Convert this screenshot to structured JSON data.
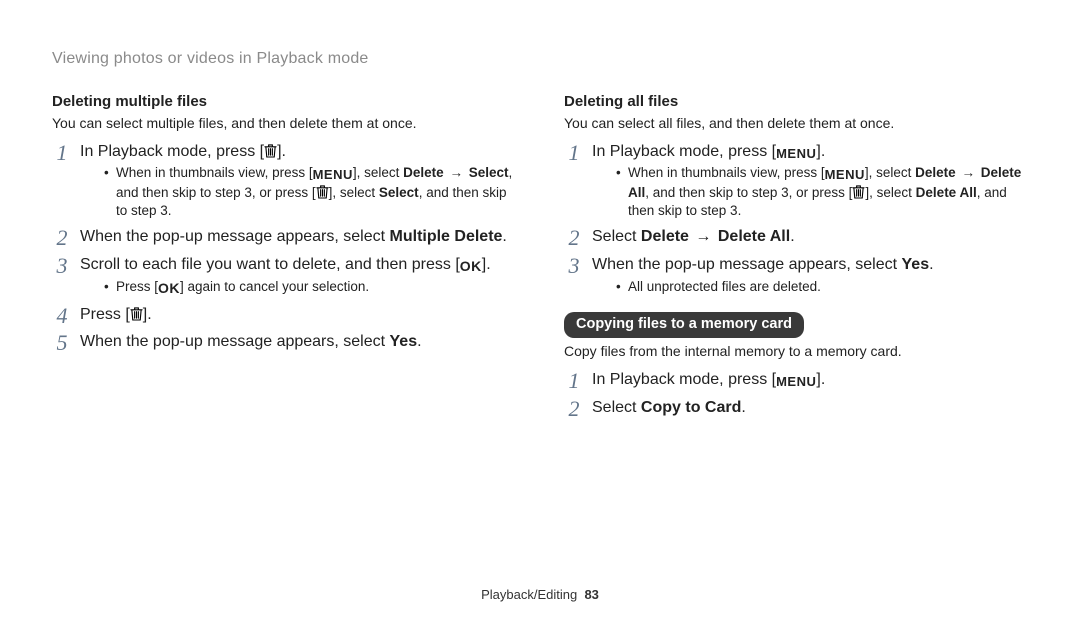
{
  "page_header": "Viewing photos or videos in Playback mode",
  "footer": {
    "section": "Playback/Editing",
    "page": "83"
  },
  "icons": {
    "menu": "MENU",
    "ok": "OK",
    "arrow": "→"
  },
  "left": {
    "heading": "Deleting multiple files",
    "intro": "You can select multiple files, and then delete them at once.",
    "step1_a": "In Playback mode, press [",
    "step1_b": "].",
    "step1_bullet_a": "When in thumbnails view, press [",
    "step1_bullet_b": "], select ",
    "step1_bullet_delete": "Delete",
    "step1_bullet_c": " ",
    "step1_bullet_select": "Select",
    "step1_bullet_d": ", and then skip to step 3, or press [",
    "step1_bullet_e": "], select ",
    "step1_bullet_select2": "Select",
    "step1_bullet_f": ", and then skip to step 3.",
    "step2_a": "When the pop-up message appears, select ",
    "step2_b": "Multiple Delete",
    "step2_c": ".",
    "step3_a": "Scroll to each file you want to delete, and then press [",
    "step3_b": "].",
    "step3_bullet_a": "Press [",
    "step3_bullet_b": "] again to cancel your selection.",
    "step4_a": "Press [",
    "step4_b": "].",
    "step5_a": "When the pop-up message appears, select ",
    "step5_b": "Yes",
    "step5_c": "."
  },
  "right": {
    "heading": "Deleting all files",
    "intro": "You can select all files, and then delete them at once.",
    "step1_a": "In Playback mode, press [",
    "step1_b": "].",
    "step1_bullet_a": "When in thumbnails view, press [",
    "step1_bullet_b": "], select ",
    "step1_bullet_delete": "Delete",
    "step1_bullet_c": " ",
    "step1_bullet_deleteall": "Delete All",
    "step1_bullet_d": ", and then skip to step 3, or press [",
    "step1_bullet_e": "], select ",
    "step1_bullet_deleteall2": "Delete All",
    "step1_bullet_f": ", and then skip to step 3.",
    "step2_a": "Select ",
    "step2_b": "Delete",
    "step2_c": " ",
    "step2_d": "Delete All",
    "step2_e": ".",
    "step3_a": "When the pop-up message appears, select ",
    "step3_b": "Yes",
    "step3_c": ".",
    "step3_bullet": "All unprotected files are deleted.",
    "copy_heading": "Copying files to a memory card",
    "copy_intro": "Copy files from the internal memory to a memory card.",
    "copy_step1_a": "In Playback mode, press [",
    "copy_step1_b": "].",
    "copy_step2_a": "Select ",
    "copy_step2_b": "Copy to Card",
    "copy_step2_c": "."
  }
}
